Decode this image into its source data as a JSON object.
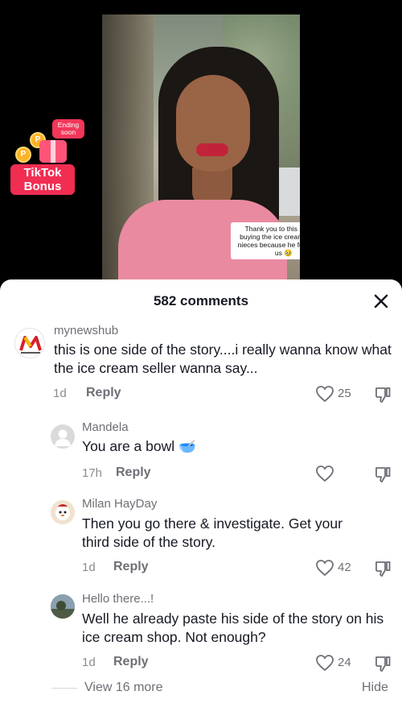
{
  "video": {
    "caption": "Thank you to this man for buying the ice creams for my nieces because he felt bad for us 🥹"
  },
  "bonus_badge": {
    "tag_text": "Ending soon",
    "label": "TikTok Bonus"
  },
  "comments_sheet": {
    "title": "582 comments",
    "view_more_label": "View 16 more",
    "hide_label": "Hide"
  },
  "comments": [
    {
      "username": "mynewshub",
      "text": "this is one side of the story....i really wanna know what the ice cream seller wanna say...",
      "time": "1d",
      "reply_label": "Reply",
      "likes": "25",
      "avatar_icon": "mynewshub-logo-icon"
    },
    {
      "username": "Mandela",
      "text": "You are a bowl 🥣",
      "time": "17h",
      "reply_label": "Reply",
      "likes": "",
      "avatar_icon": "default-avatar-icon"
    },
    {
      "username": "Milan HayDay",
      "text": "Then you go there & investigate. Get your third side of the story.",
      "time": "1d",
      "reply_label": "Reply",
      "likes": "42",
      "avatar_icon": "cartoon-avatar-icon"
    },
    {
      "username": "Hello there...!",
      "text": "Well he already paste his side of the story on his ice cream shop. Not enough?",
      "time": "1d",
      "reply_label": "Reply",
      "likes": "24",
      "avatar_icon": "photo-avatar-icon"
    }
  ],
  "colors": {
    "text_primary": "#161823",
    "text_secondary": "#6e6f76",
    "bonus_red": "#f12d52",
    "lip_red": "#c1243a"
  }
}
